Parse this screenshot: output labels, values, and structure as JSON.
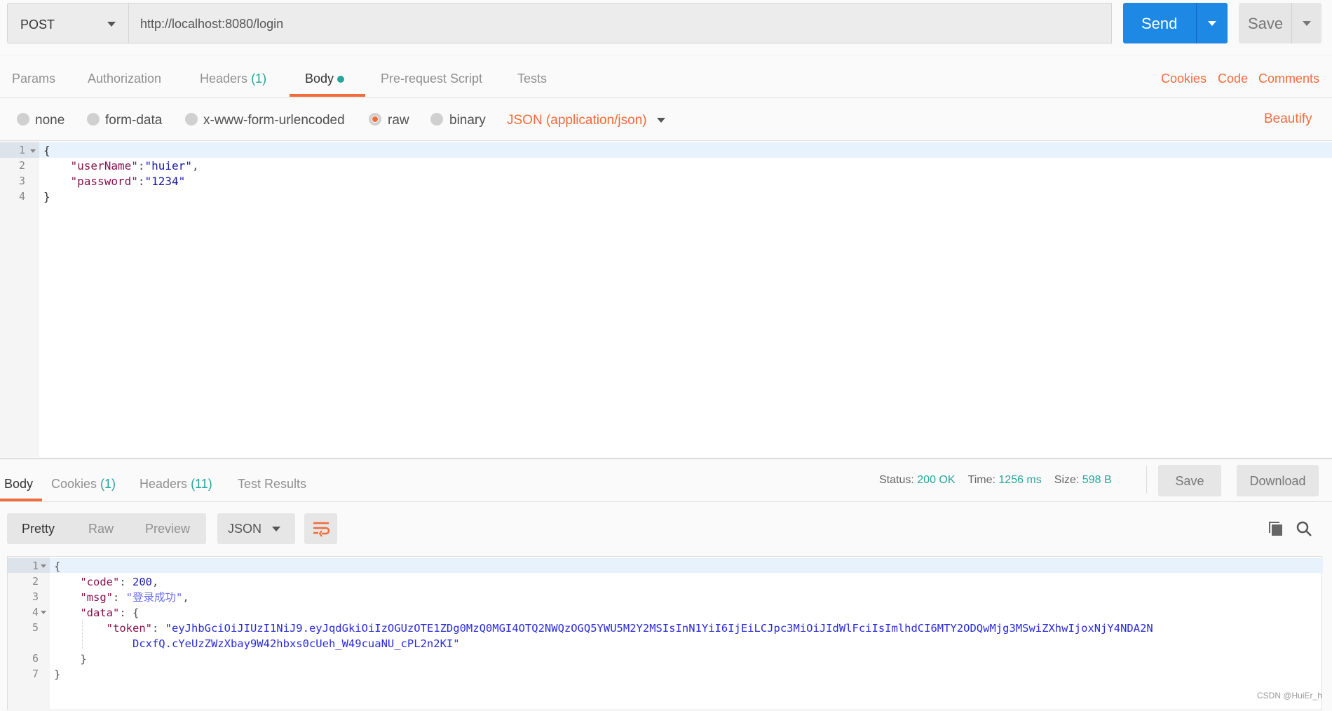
{
  "request": {
    "method": "POST",
    "url": "http://localhost:8080/login",
    "send_label": "Send",
    "save_label": "Save"
  },
  "tabs": [
    {
      "label": "Params"
    },
    {
      "label": "Authorization"
    },
    {
      "label": "Headers",
      "count": "(1)"
    },
    {
      "label": "Body",
      "active": true
    },
    {
      "label": "Pre-request Script"
    },
    {
      "label": "Tests"
    }
  ],
  "right_links": {
    "cookies": "Cookies",
    "code": "Code",
    "comments": "Comments"
  },
  "body_types": {
    "options": [
      "none",
      "form-data",
      "x-www-form-urlencoded",
      "raw",
      "binary"
    ],
    "selected": "raw",
    "content_type": "JSON (application/json)",
    "beautify": "Beautify"
  },
  "request_body": {
    "line_numbers": [
      "1",
      "2",
      "3",
      "4"
    ],
    "open": "{",
    "k1": "\"userName\"",
    "v1": "\"huier\"",
    "k2": "\"password\"",
    "v2": "\"1234\"",
    "close": "}"
  },
  "response": {
    "tabs": [
      {
        "label": "Body",
        "active": true
      },
      {
        "label": "Cookies",
        "count": "(1)"
      },
      {
        "label": "Headers",
        "count": "(11)"
      },
      {
        "label": "Test Results"
      }
    ],
    "status_label": "Status:",
    "status": "200 OK",
    "time_label": "Time:",
    "time": "1256 ms",
    "size_label": "Size:",
    "size": "598 B",
    "save_label": "Save",
    "download_label": "Download",
    "views": [
      "Pretty",
      "Raw",
      "Preview"
    ],
    "format": "JSON",
    "line_numbers": [
      "1",
      "2",
      "3",
      "4",
      "5",
      "",
      "6",
      "7"
    ],
    "code_key": "\"code\"",
    "code_val": "200",
    "msg_key": "\"msg\"",
    "msg_val": "\"登录成功\"",
    "data_key": "\"data\"",
    "token_key": "\"token\"",
    "token_line1": "\"eyJhbGciOiJIUzI1NiJ9.eyJqdGkiOiIzOGUzOTE1ZDg0MzQ0MGI4OTQ2NWQzOGQ5YWU5M2Y2MSIsInN1YiI6IjEiLCJpc3MiOiJIdWlFciIsImlhdCI6MTY2ODQwMjg3MSwiZXhwIjoxNjY4NDA2N",
    "token_line2": "DcxfQ.cYeUzZWzXbay9W42hbxs0cUeh_W49cuaNU_cPL2n2KI\""
  },
  "watermark": "CSDN @HuiEr_h",
  "colors": {
    "accent": "#f26b3a",
    "send": "#1e88e5",
    "status_green": "#26a69a"
  }
}
